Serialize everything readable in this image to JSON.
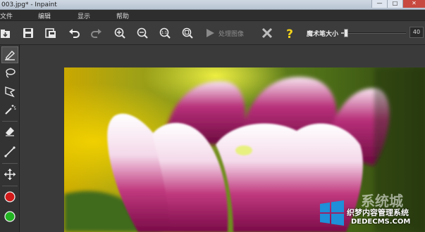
{
  "window": {
    "title": "003.jpg* - Inpaint",
    "controls": [
      "—",
      "□",
      "✕"
    ]
  },
  "menu": [
    "文件",
    "编辑",
    "显示",
    "帮助"
  ],
  "toolbar": {
    "icons": [
      "open-icon",
      "save-icon",
      "save-as-icon",
      "undo-icon",
      "redo-icon",
      "zoom-in-icon",
      "zoom-out-icon",
      "actual-size-icon",
      "fit-window-icon"
    ],
    "process_label": "处理图像",
    "brush_size_label": "魔术笔大小",
    "brush_size_value": "40",
    "brush_size_fraction": 0.08
  },
  "tools": [
    "marker-icon",
    "lasso-icon",
    "polygon-lasso-icon",
    "magic-wand-icon",
    "eraser-icon",
    "line-icon",
    "move-icon",
    "red-marker",
    "green-marker"
  ],
  "colors": {
    "mark_red": "#d21a1a",
    "mark_green": "#22b422",
    "help_yellow": "#f3d31a"
  },
  "watermark": {
    "brand": "系统城",
    "domain": "DEDECMS.COM",
    "tagline": "织梦内容管理系统"
  }
}
